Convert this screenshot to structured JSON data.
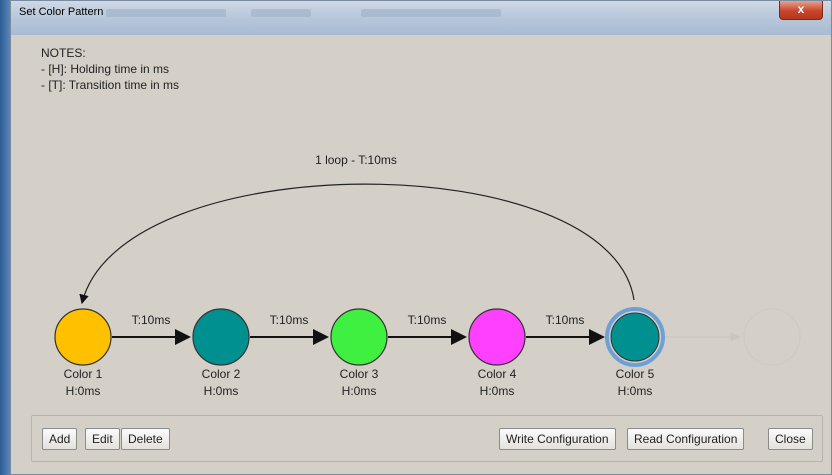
{
  "window": {
    "title": "Set Color Pattern",
    "close_label": "x"
  },
  "notes": {
    "heading": "NOTES:",
    "lines": [
      "- [H]: Holding time in ms",
      "- [T]: Transition time in ms"
    ]
  },
  "loop_label": "1 loop - T:10ms",
  "transitions": [
    "T:10ms",
    "T:10ms",
    "T:10ms",
    "T:10ms"
  ],
  "colors": [
    {
      "name": "Color 1",
      "hold": "H:0ms",
      "fill": "#ffc000"
    },
    {
      "name": "Color 2",
      "hold": "H:0ms",
      "fill": "#009090"
    },
    {
      "name": "Color 3",
      "hold": "H:0ms",
      "fill": "#40f040"
    },
    {
      "name": "Color 4",
      "hold": "H:0ms",
      "fill": "#ff40ff"
    },
    {
      "name": "Color 5",
      "hold": "H:0ms",
      "fill": "#009090",
      "selected": true
    }
  ],
  "buttons": {
    "add": "Add",
    "edit": "Edit",
    "delete": "Delete",
    "write": "Write Configuration",
    "read": "Read Configuration",
    "close": "Close"
  },
  "accent_colors": {
    "selected_ring": "#6ea0d8",
    "placeholder": "#c8c5be"
  }
}
